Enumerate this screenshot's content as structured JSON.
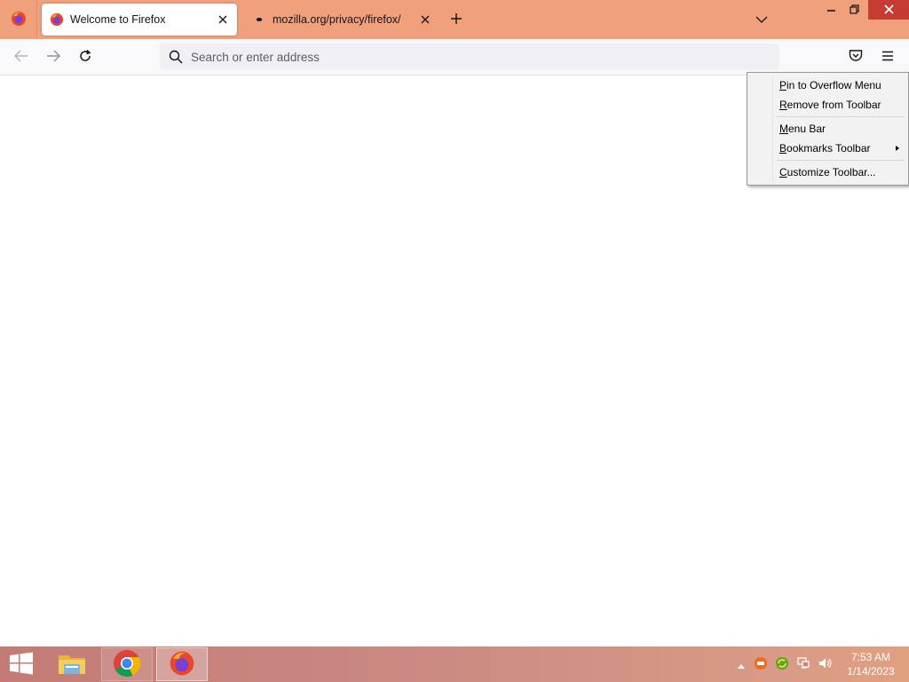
{
  "browser": {
    "tabs": [
      {
        "title": "Welcome to Firefox",
        "active": true,
        "icon": "firefox-icon"
      },
      {
        "title": "mozilla.org/privacy/firefox/",
        "active": false,
        "icon": "dot-favicon"
      }
    ],
    "url_placeholder": "Search or enter address",
    "url_value": "",
    "accent_color": "#f0a07a"
  },
  "context_menu": {
    "items": [
      {
        "accel": "P",
        "rest": "in to Overflow Menu",
        "has_submenu": false
      },
      {
        "accel": "R",
        "rest": "emove from Toolbar",
        "has_submenu": false
      },
      {
        "accel": "M",
        "rest": "enu Bar",
        "has_submenu": false
      },
      {
        "accel": "B",
        "rest": "ookmarks Toolbar",
        "has_submenu": true
      },
      {
        "accel": "C",
        "rest": "ustomize Toolbar...",
        "has_submenu": false
      }
    ]
  },
  "taskbar": {
    "apps": [
      "file-explorer-icon",
      "chrome-icon",
      "firefox-icon"
    ],
    "clock": {
      "time": "7:53 AM",
      "date": "1/14/2023"
    }
  }
}
